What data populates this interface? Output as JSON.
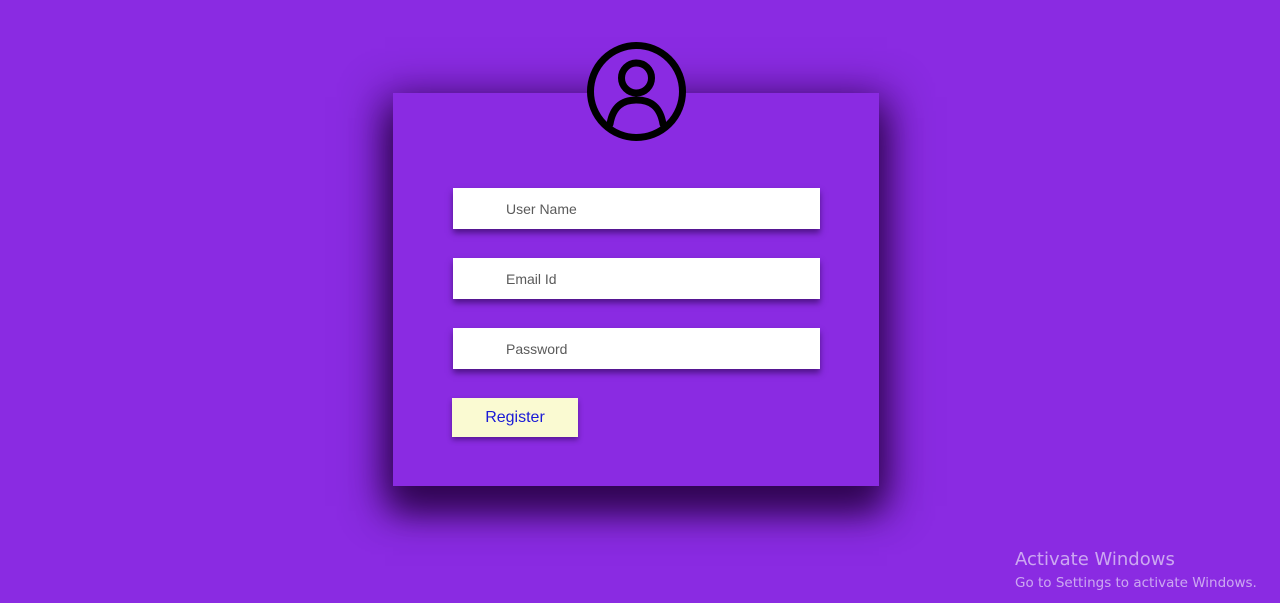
{
  "theme": {
    "background": "#8a2be2",
    "card_background": "#8a2be2",
    "button_background": "#fafad2",
    "button_text": "#1a1ad6"
  },
  "avatar": {
    "icon": "user-circle-icon"
  },
  "form": {
    "username": {
      "placeholder": "User Name",
      "value": ""
    },
    "email": {
      "placeholder": "Email Id",
      "value": ""
    },
    "password": {
      "placeholder": "Password",
      "value": ""
    },
    "submit_label": "Register"
  },
  "watermark": {
    "title": "Activate Windows",
    "subtitle": "Go to Settings to activate Windows."
  }
}
